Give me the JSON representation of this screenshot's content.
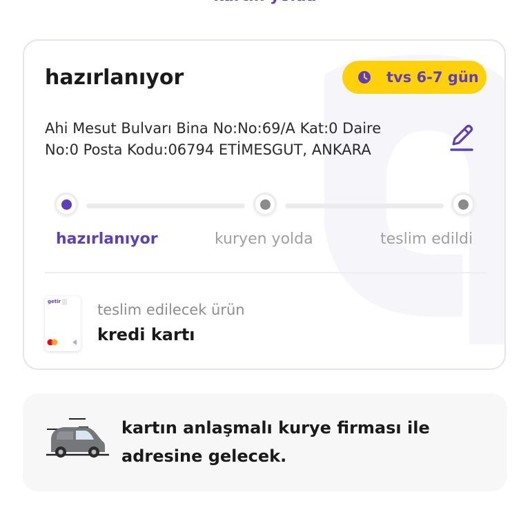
{
  "header": {
    "partial_title": "kartın yolda"
  },
  "status_card": {
    "title": "hazırlanıyor",
    "eta_badge": "tvs 6-7 gün",
    "address_line1": "Ahi Mesut Bulvarı Bina No:No:69/A Kat:0 Daire",
    "address_line2": "No:0 Posta Kodu:06794 ETİMESGUT, ANKARA",
    "steps": [
      {
        "label": "hazırlanıyor",
        "state": "active"
      },
      {
        "label": "kuryen yolda",
        "state": "pending"
      },
      {
        "label": "teslim edildi",
        "state": "pending"
      }
    ],
    "product": {
      "thumbnail_brand": "getir",
      "subtitle": "teslim edilecek ürün",
      "name": "kredi kartı"
    }
  },
  "info_card": {
    "line1": "kartın anlaşmalı kurye firması ile",
    "line2": "adresine gelecek."
  },
  "colors": {
    "brand_purple": "#5d3ebc",
    "badge_yellow": "#ffd10d",
    "inactive_gray": "#a0a0a0"
  },
  "icons": {
    "clock": "clock-icon",
    "edit": "pencil-icon",
    "courier": "delivery-van-icon"
  }
}
